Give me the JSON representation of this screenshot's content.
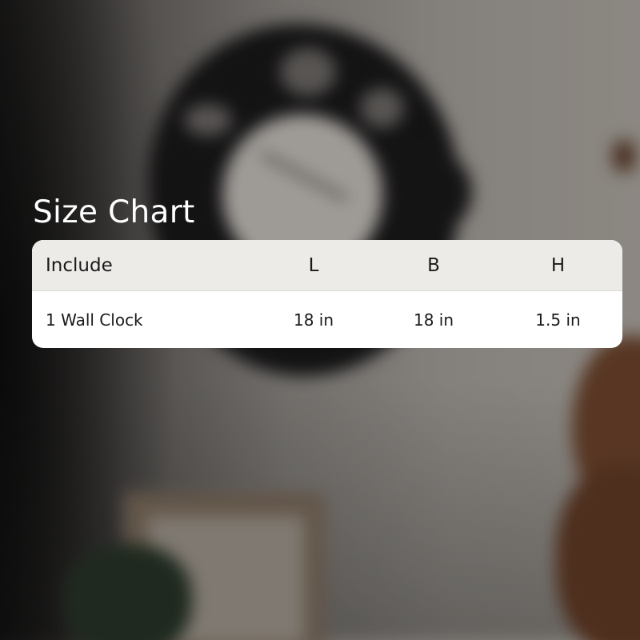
{
  "title": "Size Chart",
  "table": {
    "headers": [
      "Include",
      "L",
      "B",
      "H"
    ],
    "rows": [
      [
        "1 Wall Clock",
        "18 in",
        "18 in",
        "1.5 in"
      ]
    ]
  },
  "colors": {
    "title_text": "#ffffff",
    "header_bg": "#edebe7",
    "body_bg": "#ffffff",
    "cell_text": "#1a1a1a"
  }
}
